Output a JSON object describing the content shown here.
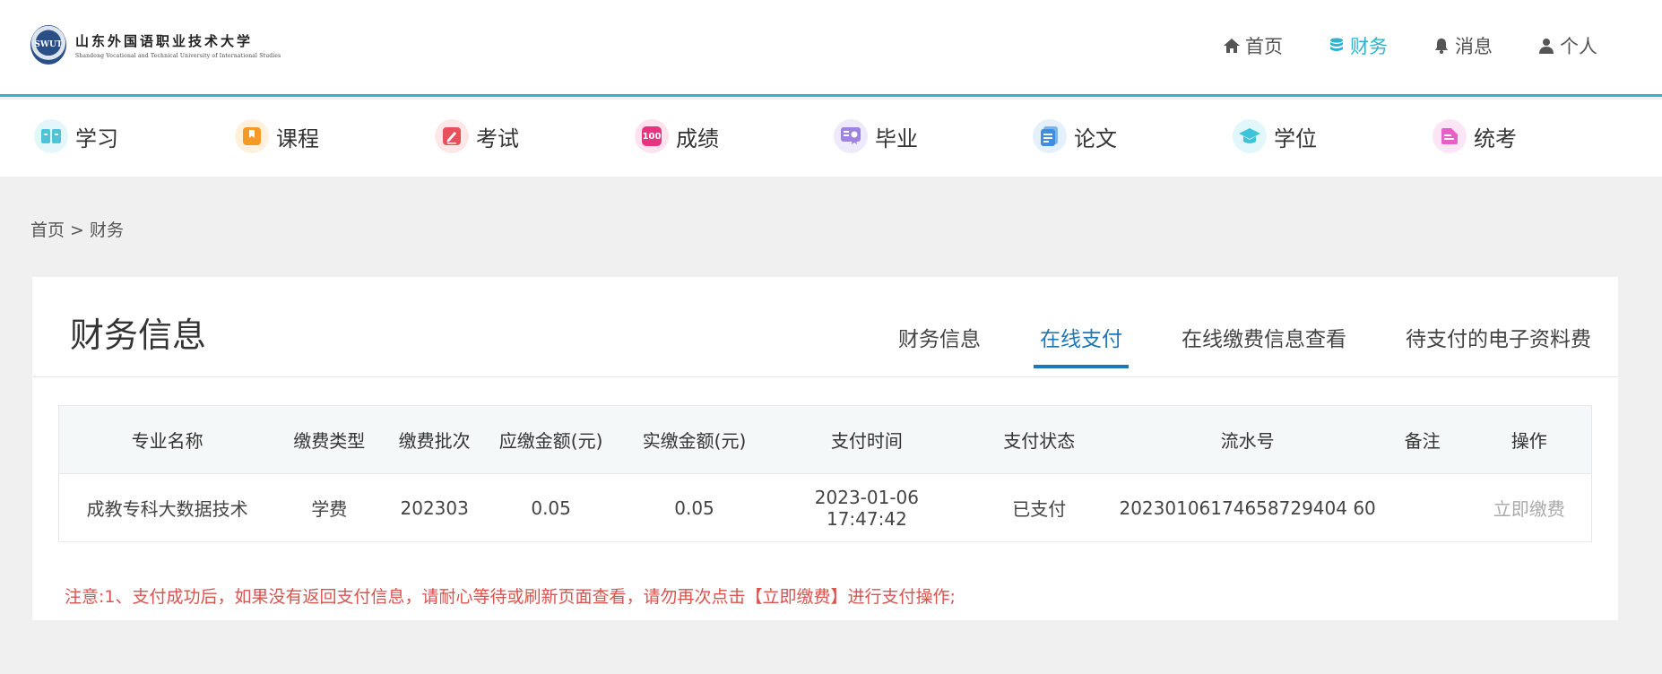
{
  "logo": {
    "seal_text": "SWUT",
    "name_cn": "山东外国语职业技术大学",
    "name_en": "Shandong Vocational and Technical University of International Studies"
  },
  "topnav": [
    {
      "label": "首页",
      "icon": "home-icon"
    },
    {
      "label": "财务",
      "icon": "database-icon",
      "active": true
    },
    {
      "label": "消息",
      "icon": "bell-icon"
    },
    {
      "label": "个人",
      "icon": "user-icon"
    }
  ],
  "modules": [
    {
      "label": "学习",
      "icon": "book-open-icon",
      "color": "#4fc3d9",
      "bg": "#e3f7fa"
    },
    {
      "label": "课程",
      "icon": "bookmark-icon",
      "color": "#f59a23",
      "bg": "#fff1de"
    },
    {
      "label": "考试",
      "icon": "pen-icon",
      "color": "#e8505b",
      "bg": "#fde7e9"
    },
    {
      "label": "成绩",
      "icon": "score-icon",
      "color": "#e8347e",
      "bg": "#fde3ee"
    },
    {
      "label": "毕业",
      "icon": "certificate-icon",
      "color": "#9d84e0",
      "bg": "#efeafb"
    },
    {
      "label": "论文",
      "icon": "document-icon",
      "color": "#3f8de0",
      "bg": "#e4f0fc"
    },
    {
      "label": "学位",
      "icon": "graduation-cap-icon",
      "color": "#3fc3d9",
      "bg": "#e1f7fa"
    },
    {
      "label": "统考",
      "icon": "folder-icon",
      "color": "#e85fc7",
      "bg": "#fce6f6"
    }
  ],
  "breadcrumb": {
    "home": "首页",
    "sep": ">",
    "current": "财务"
  },
  "panel": {
    "title": "财务信息",
    "tabs": [
      {
        "label": "财务信息"
      },
      {
        "label": "在线支付",
        "active": true
      },
      {
        "label": "在线缴费信息查看"
      },
      {
        "label": "待支付的电子资料费"
      }
    ]
  },
  "table": {
    "headers": [
      "专业名称",
      "缴费类型",
      "缴费批次",
      "应缴金额(元)",
      "实缴金额(元)",
      "支付时间",
      "支付状态",
      "流水号",
      "备注",
      "操作"
    ],
    "rows": [
      [
        "成教专科大数据技术",
        "学费",
        "202303",
        "0.05",
        "0.05",
        "2023-01-06 17:47:42",
        "已支付",
        "20230106174658729404 60",
        "",
        "立即缴费"
      ]
    ]
  },
  "notice": "注意:1、支付成功后，如果没有返回支付信息，请耐心等待或刷新页面查看，请勿再次点击【立即缴费】进行支付操作;"
}
